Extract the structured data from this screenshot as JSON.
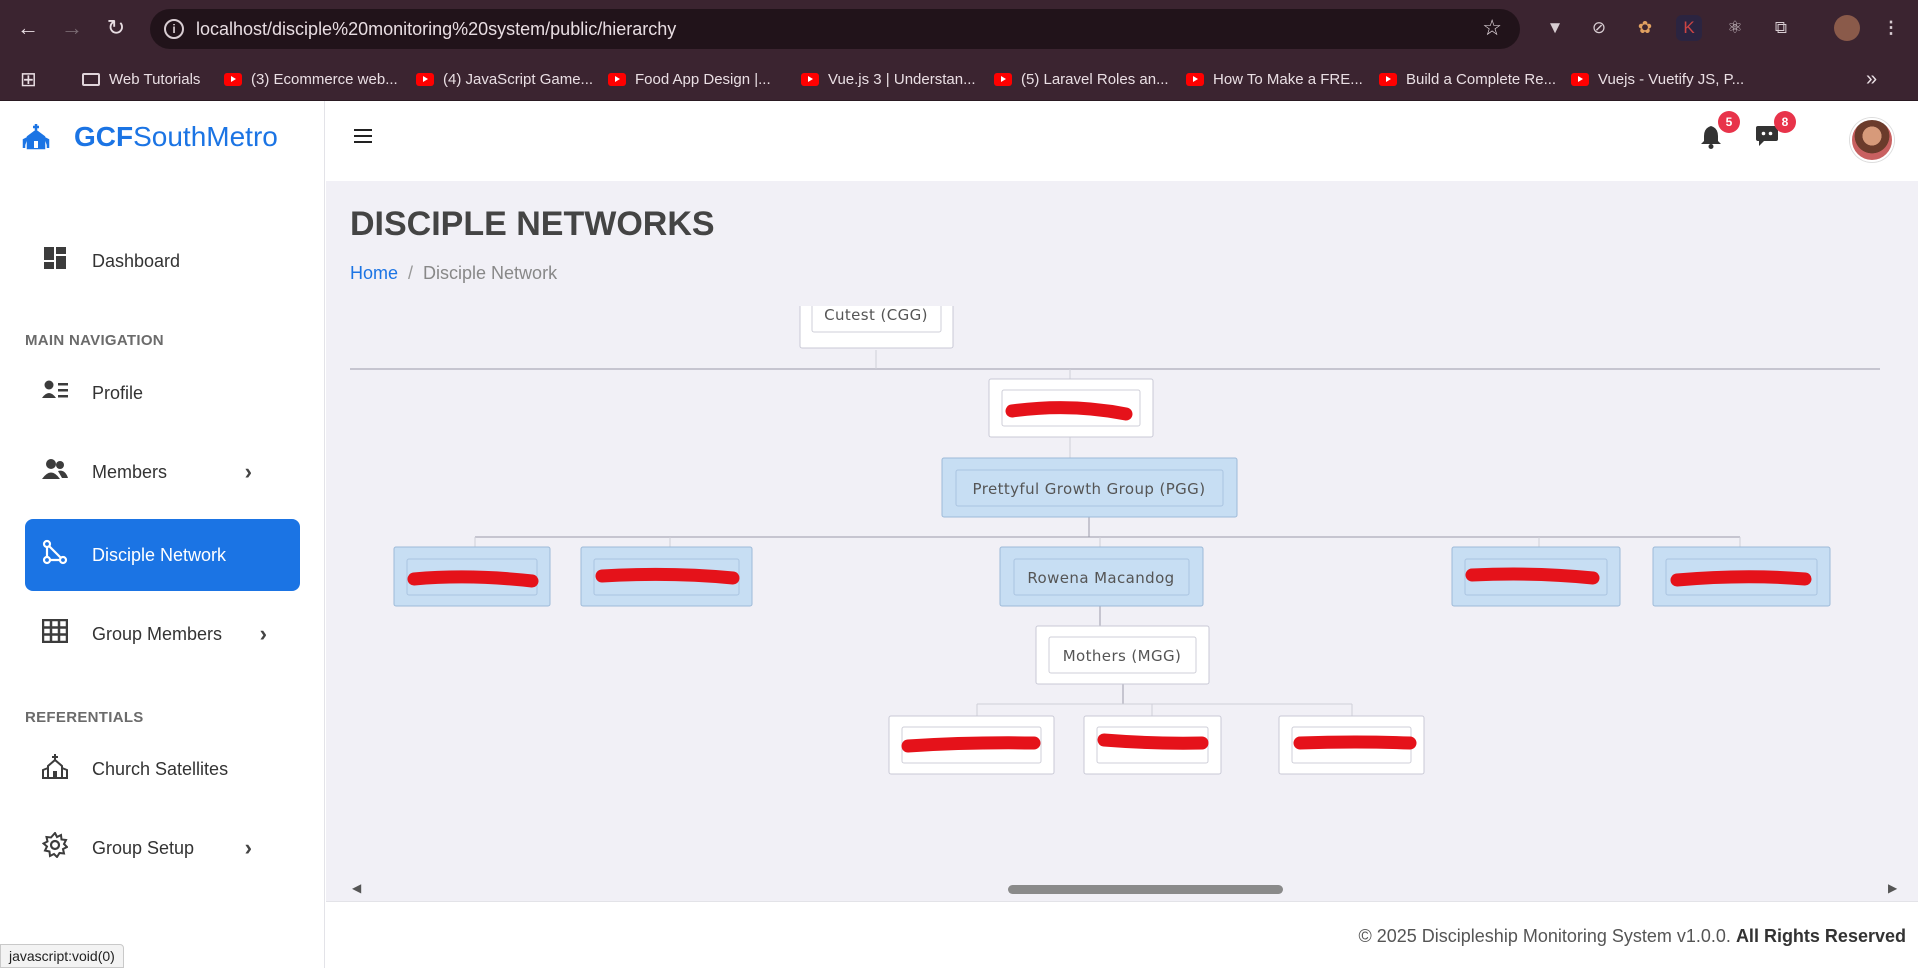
{
  "browser": {
    "url": "localhost/disciple%20monitoring%20system/public/hierarchy",
    "bookmarks": [
      {
        "label": "Web Tutorials",
        "type": "folder"
      },
      {
        "label": "(3) Ecommerce web...",
        "type": "youtube"
      },
      {
        "label": "(4) JavaScript Game...",
        "type": "youtube"
      },
      {
        "label": "Food App Design |...",
        "type": "youtube"
      },
      {
        "label": "Vue.js 3 | Understan...",
        "type": "youtube"
      },
      {
        "label": "(5) Laravel Roles an...",
        "type": "youtube"
      },
      {
        "label": "How To Make a FRE...",
        "type": "youtube"
      },
      {
        "label": "Build a Complete Re...",
        "type": "youtube"
      },
      {
        "label": "Vuejs - Vuetify JS, P...",
        "type": "youtube"
      }
    ],
    "status_tip": "javascript:void(0)"
  },
  "brand": {
    "bold": "GCF",
    "rest": "SouthMetro",
    "color": "#1b74e4"
  },
  "sidebar": {
    "dashboard": "Dashboard",
    "main_nav_label": "MAIN NAVIGATION",
    "items": [
      {
        "label": "Profile",
        "icon": "profile-icon"
      },
      {
        "label": "Members",
        "icon": "members-icon"
      },
      {
        "label": "Disciple Network",
        "icon": "network-icon",
        "active": true
      },
      {
        "label": "Group Members",
        "icon": "grid-icon"
      }
    ],
    "referentials_label": "REFERENTIALS",
    "ref_items": [
      {
        "label": "Church Satellites",
        "icon": "church-icon"
      },
      {
        "label": "Group Setup",
        "icon": "gear-icon"
      }
    ]
  },
  "header": {
    "notifications_count": "5",
    "messages_count": "8"
  },
  "page": {
    "title": "DISCIPLE NETWORKS",
    "breadcrumb_home": "Home",
    "breadcrumb_current": "Disciple Network"
  },
  "chart": {
    "nodes": {
      "cgg": "Cutest (CGG)",
      "pgg": "Prettyful Growth Group (PGG)",
      "rowena": "Rowena Macandog",
      "mgg": "Mothers (MGG)"
    }
  },
  "footer": {
    "text": "© 2025 Discipleship Monitoring System v1.0.0.",
    "rights": "All Rights Reserved"
  },
  "colors": {
    "accent": "#1b74e4",
    "badge": "#e8334a",
    "node_blue": "#c7def3"
  }
}
